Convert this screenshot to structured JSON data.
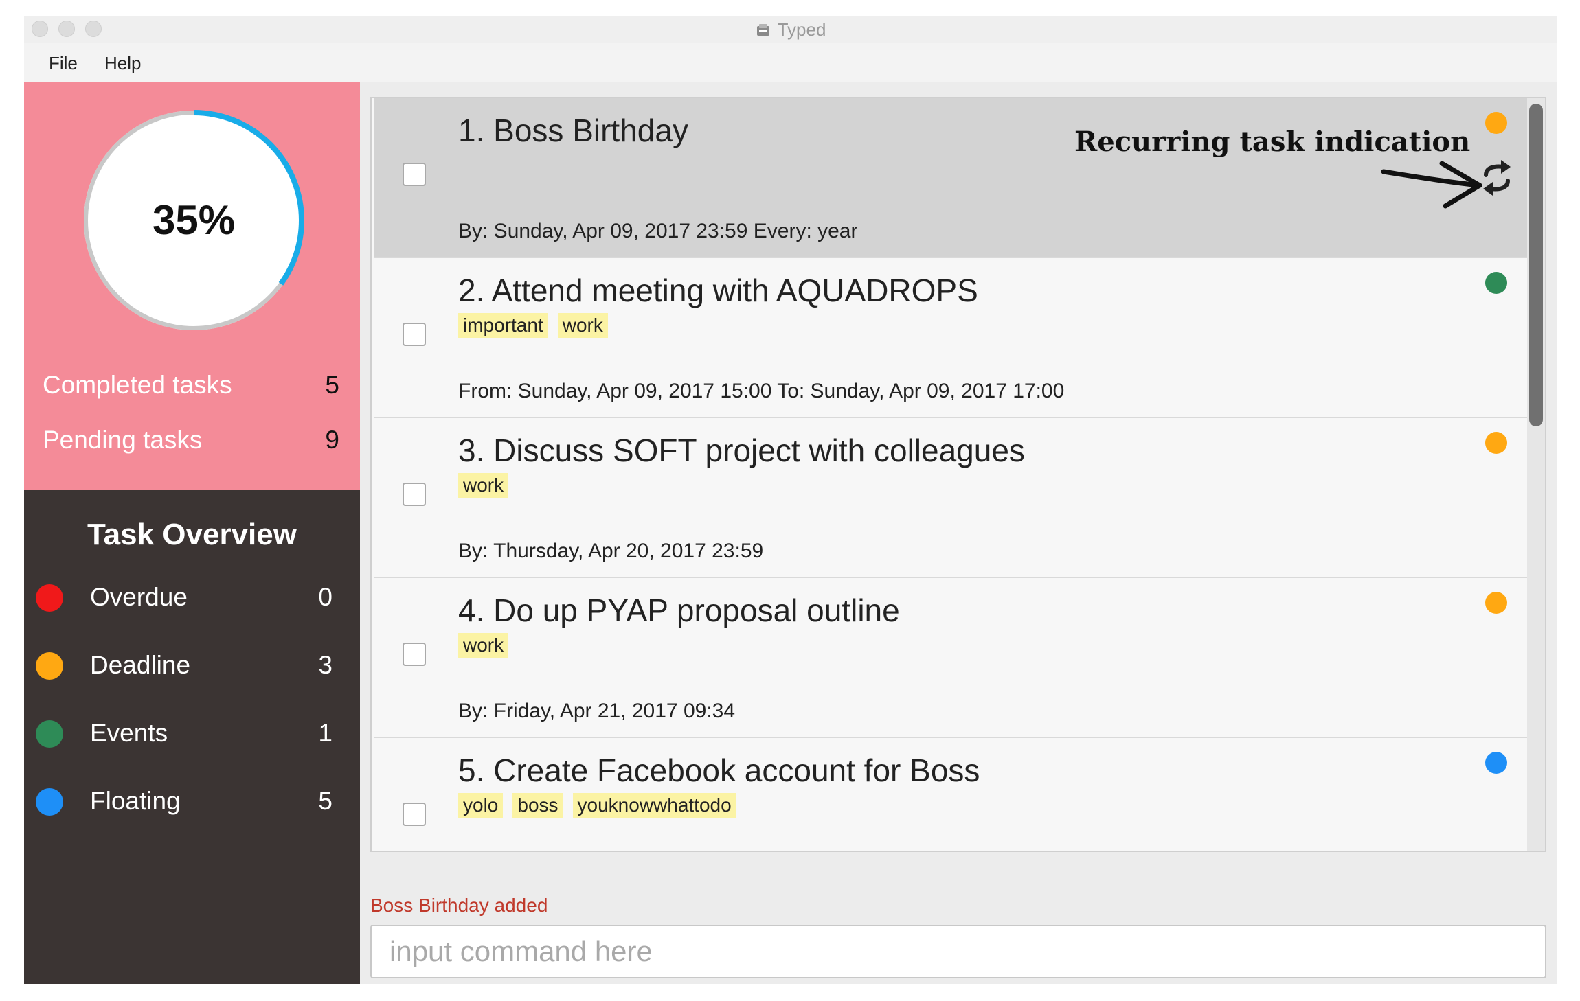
{
  "window": {
    "title": "Typed"
  },
  "menu": {
    "file": "File",
    "help": "Help"
  },
  "summary": {
    "progress_percent": 35,
    "progress_label": "35%",
    "completed_label": "Completed tasks",
    "completed_count": "5",
    "pending_label": "Pending tasks",
    "pending_count": "9"
  },
  "overview": {
    "title": "Task Overview",
    "rows": [
      {
        "label": "Overdue",
        "count": "0",
        "color": "#f0191a"
      },
      {
        "label": "Deadline",
        "count": "3",
        "color": "#ffa812"
      },
      {
        "label": "Events",
        "count": "1",
        "color": "#2e8b57"
      },
      {
        "label": "Floating",
        "count": "5",
        "color": "#1e8ff7"
      }
    ]
  },
  "tasks": [
    {
      "title": "1. Boss Birthday",
      "tags": [],
      "date": "By: Sunday, Apr 09, 2017 23:59 Every: year",
      "dot_color": "#ffa812",
      "recurring": true,
      "selected": true
    },
    {
      "title": "2. Attend meeting with AQUADROPS",
      "tags": [
        "important",
        "work"
      ],
      "date": "From: Sunday, Apr 09, 2017 15:00 To: Sunday, Apr 09, 2017 17:00",
      "dot_color": "#2e8b57",
      "recurring": false,
      "selected": false
    },
    {
      "title": "3. Discuss SOFT project with colleagues",
      "tags": [
        "work"
      ],
      "date": "By: Thursday, Apr 20, 2017 23:59",
      "dot_color": "#ffa812",
      "recurring": false,
      "selected": false
    },
    {
      "title": "4. Do up PYAP proposal outline",
      "tags": [
        "work"
      ],
      "date": "By: Friday, Apr 21, 2017 09:34",
      "dot_color": "#ffa812",
      "recurring": false,
      "selected": false
    },
    {
      "title": "5. Create Facebook account for Boss",
      "tags": [
        "yolo",
        "boss",
        "youknowwhattodo"
      ],
      "date": "",
      "dot_color": "#1e8ff7",
      "recurring": false,
      "selected": false
    }
  ],
  "annotation": {
    "text": "Recurring task indication"
  },
  "icons": {
    "recurring": "repeat-icon",
    "app": "app-icon"
  },
  "status": {
    "message": "Boss Birthday added"
  },
  "command": {
    "placeholder": "input command here",
    "value": ""
  }
}
